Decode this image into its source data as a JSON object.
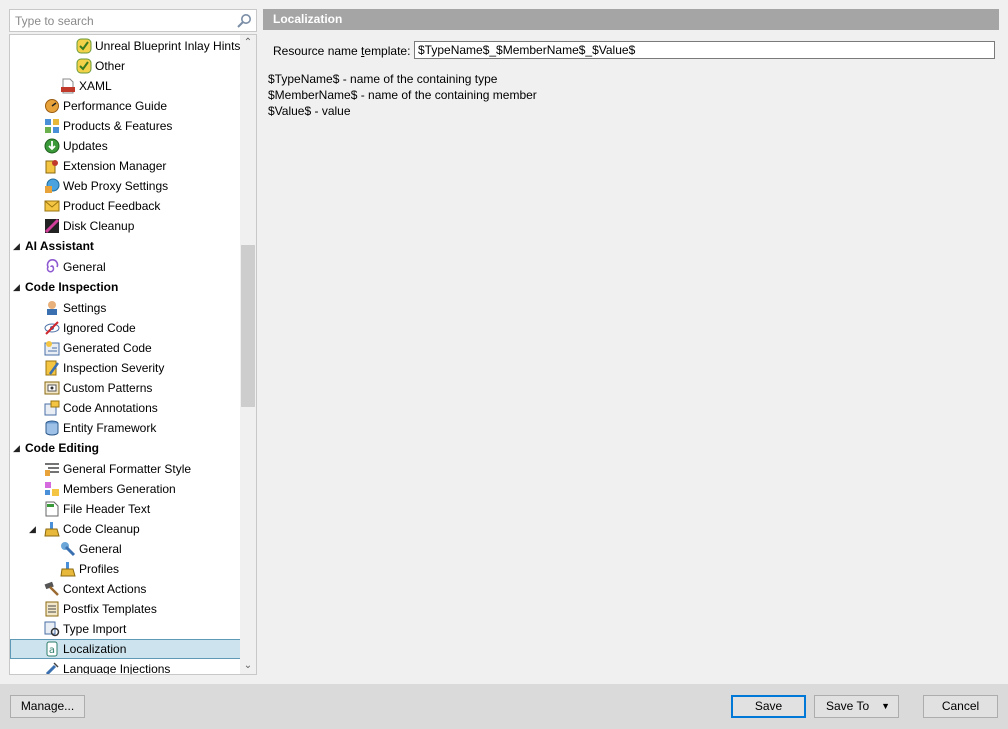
{
  "search": {
    "placeholder": "Type to search",
    "icon": "search-icon"
  },
  "tree": {
    "items": [
      {
        "label": "Unreal Blueprint Inlay Hints",
        "icon": "inlay-hints-icon",
        "type": "item"
      },
      {
        "label": "Other",
        "icon": "inlay-hints-icon",
        "type": "item"
      },
      {
        "label": "XAML",
        "icon": "xaml-icon",
        "type": "item"
      },
      {
        "label": "Performance Guide",
        "icon": "performance-guide-icon",
        "type": "item"
      },
      {
        "label": "Products & Features",
        "icon": "products-features-icon",
        "type": "item"
      },
      {
        "label": "Updates",
        "icon": "updates-icon",
        "type": "item"
      },
      {
        "label": "Extension Manager",
        "icon": "extension-manager-icon",
        "type": "item"
      },
      {
        "label": "Web Proxy Settings",
        "icon": "web-proxy-icon",
        "type": "item"
      },
      {
        "label": "Product Feedback",
        "icon": "feedback-icon",
        "type": "item"
      },
      {
        "label": "Disk Cleanup",
        "icon": "disk-cleanup-icon",
        "type": "item"
      },
      {
        "label": "AI Assistant",
        "type": "category"
      },
      {
        "label": "General",
        "icon": "ai-general-icon",
        "type": "item"
      },
      {
        "label": "Code Inspection",
        "type": "category"
      },
      {
        "label": "Settings",
        "icon": "settings-icon",
        "type": "item"
      },
      {
        "label": "Ignored Code",
        "icon": "ignored-code-icon",
        "type": "item"
      },
      {
        "label": "Generated Code",
        "icon": "generated-code-icon",
        "type": "item"
      },
      {
        "label": "Inspection Severity",
        "icon": "inspection-severity-icon",
        "type": "item"
      },
      {
        "label": "Custom Patterns",
        "icon": "custom-patterns-icon",
        "type": "item"
      },
      {
        "label": "Code Annotations",
        "icon": "code-annotations-icon",
        "type": "item"
      },
      {
        "label": "Entity Framework",
        "icon": "entity-framework-icon",
        "type": "item"
      },
      {
        "label": "Code Editing",
        "type": "category"
      },
      {
        "label": "General Formatter Style",
        "icon": "formatter-icon",
        "type": "item"
      },
      {
        "label": "Members Generation",
        "icon": "members-generation-icon",
        "type": "item"
      },
      {
        "label": "File Header Text",
        "icon": "file-header-icon",
        "type": "item"
      },
      {
        "label": "Code Cleanup",
        "icon": "broom-icon",
        "type": "item"
      },
      {
        "label": "General",
        "icon": "wrench-icon",
        "type": "item"
      },
      {
        "label": "Profiles",
        "icon": "broom-icon",
        "type": "item"
      },
      {
        "label": "Context Actions",
        "icon": "hammer-icon",
        "type": "item"
      },
      {
        "label": "Postfix Templates",
        "icon": "postfix-icon",
        "type": "item"
      },
      {
        "label": "Type Import",
        "icon": "type-import-icon",
        "type": "item"
      },
      {
        "label": "Localization",
        "icon": "localization-icon",
        "type": "item",
        "selected": true
      },
      {
        "label": "Language Injections",
        "icon": "syringe-icon",
        "type": "item"
      }
    ]
  },
  "panel": {
    "title": "Localization",
    "field_label_pre": "Resource name ",
    "field_label_accel": "t",
    "field_label_post": "emplate:",
    "field_value": "$TypeName$_$MemberName$_$Value$",
    "help": [
      "$TypeName$ - name of the containing type",
      "$MemberName$ - name of the containing member",
      "$Value$ - value"
    ]
  },
  "buttons": {
    "manage": "Manage...",
    "save": "Save",
    "save_to": "Save To",
    "cancel": "Cancel"
  },
  "colors": {
    "header_bg": "#a5a5a5",
    "selection_bg": "#cde3ee",
    "selection_border": "#5e9ab5",
    "default_button_border": "#0078d7"
  }
}
